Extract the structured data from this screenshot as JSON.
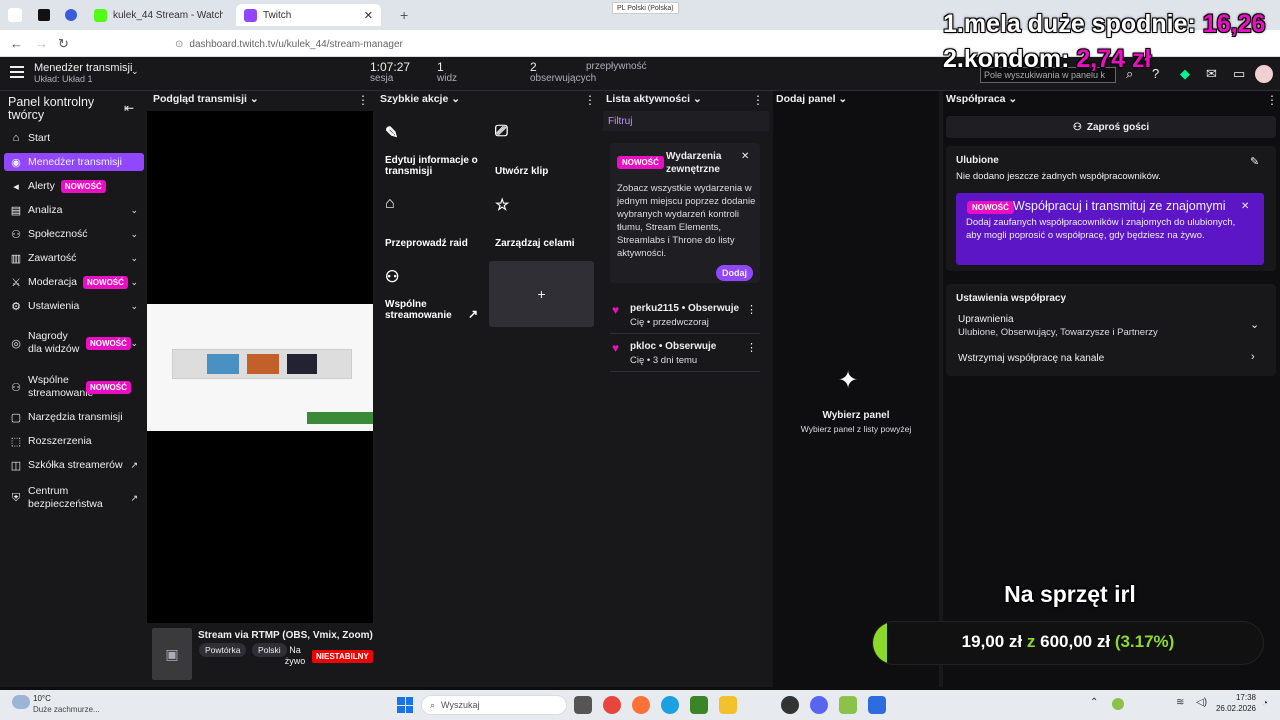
{
  "browser": {
    "tabs": [
      {
        "label": "kulek_44 Stream - Watch Live o"
      },
      {
        "label": "Twitch"
      }
    ],
    "url": "dashboard.twitch.tv/u/kulek_44/stream-manager",
    "lang_indicator": "PL Polski (Polska)"
  },
  "header": {
    "title": "Menedżer transmisji",
    "subtitle": "Układ: Układ 1",
    "stats": [
      {
        "value": "1:07:27",
        "label": "sesja"
      },
      {
        "value": "1",
        "label": "widz"
      },
      {
        "value": "2",
        "label": "obserwujących"
      },
      {
        "value": "",
        "label": "przepływność"
      }
    ],
    "search_placeholder": "Pole wyszukiwania w panelu k"
  },
  "sidebar": {
    "title": "Panel kontrolny twórcy",
    "items": [
      {
        "label": "Start",
        "icon": "home-icon"
      },
      {
        "label": "Menedżer transmisji",
        "icon": "broadcast-icon",
        "active": true
      },
      {
        "label": "Alerty",
        "icon": "megaphone-icon",
        "badge": "NOWOŚĆ"
      },
      {
        "label": "Analiza",
        "icon": "analytics-icon"
      },
      {
        "label": "Społeczność",
        "icon": "community-icon"
      },
      {
        "label": "Zawartość",
        "icon": "content-icon"
      },
      {
        "label": "Moderacja",
        "icon": "sword-icon",
        "badge": "NOWOŚĆ"
      },
      {
        "label": "Ustawienia",
        "icon": "gear-icon"
      },
      {
        "label": "Nagrody dla widzów",
        "icon": "reward-icon",
        "badge": "NOWOŚĆ"
      },
      {
        "label": "Wspólne streamowanie",
        "icon": "add-person-icon",
        "badge": "NOWOŚĆ"
      },
      {
        "label": "Narzędzia transmisji",
        "icon": "tools-icon"
      },
      {
        "label": "Rozszerzenia",
        "icon": "extensions-icon"
      },
      {
        "label": "Szkółka streamerów",
        "icon": "external-link-icon"
      },
      {
        "label": "Centrum bezpieczeństwa",
        "icon": "shield-icon"
      }
    ]
  },
  "panels": {
    "preview": {
      "title": "Podgląd transmisji",
      "stream_title": "Stream via RTMP (OBS, Vmix, Zoom) w",
      "tags": [
        "Powtórka",
        "Polski"
      ],
      "live_label": "Na żywo",
      "status_badge": "NIESTABILNY"
    },
    "quick_actions": {
      "title": "Szybkie akcje",
      "items": [
        {
          "label": "Edytuj informacje o transmisji",
          "icon": "pencil-icon",
          "color": "#9147ff"
        },
        {
          "label": "Utwórz klip",
          "icon": "clip-icon",
          "color": "#9147ff"
        },
        {
          "label": "Przeprowadź raid",
          "icon": "raid-icon",
          "color": "#eb0ec2"
        },
        {
          "label": "Zarządzaj celami",
          "icon": "star-icon",
          "color": "#eb0ec2"
        },
        {
          "label": "Wspólne streamowanie",
          "icon": "add-person-icon",
          "color": "#eb0ec2"
        }
      ],
      "add_label": "+"
    },
    "activity": {
      "title": "Lista aktywności",
      "filter": "Filtruj",
      "card": {
        "badge": "NOWOŚĆ",
        "heading": "Wydarzenia zewnętrzne",
        "body": "Zobacz wszystkie wydarzenia w jednym miejscu poprzez dodanie wybranych wydarzeń kontroli tłumu, Stream Elements, Streamlabs i Throne do listy aktywności.",
        "button": "Dodaj"
      },
      "events": [
        {
          "user": "perku2115",
          "action": "Obserwuje",
          "meta": "Cię • przedwczoraj"
        },
        {
          "user": "pkloc",
          "action": "Obserwuje",
          "meta": "Cię • 3 dni temu"
        }
      ]
    },
    "add_panel": {
      "title": "Dodaj panel",
      "empty_title": "Wybierz panel",
      "empty_sub": "Wybierz panel z listy powyżej"
    },
    "collab": {
      "title": "Współpraca",
      "invite_button": "Zaproś gości",
      "favorites_title": "Ulubione",
      "favorites_empty": "Nie dodano jeszcze żadnych współpracowników.",
      "promo_badge": "NOWOŚĆ",
      "promo_title": "Współpracuj i transmituj ze znajomymi",
      "promo_body": "Dodaj zaufanych współpracowników i znajomych do ulubionych, aby mogli poprosić o współpracę, gdy będziesz na żywo.",
      "settings_title": "Ustawienia współpracy",
      "permissions_label": "Uprawnienia",
      "permissions_value": "Ulubione, Obserwujący, Towarzysze i Partnerzy",
      "pause_label": "Wstrzymaj współpracę na kanale"
    }
  },
  "overlay": {
    "line1_text": "1.mela duże spodnie:",
    "line1_amount": "16,26",
    "line2_text": "2.kondom:",
    "line2_amount": "2,74 zł",
    "goal_title": "Na sprzęt irl",
    "goal_current": "19,00 zł",
    "goal_sep": "z",
    "goal_target": "600,00 zł",
    "goal_percent": "(3.17%)",
    "goal_fraction": 0.0317,
    "accent": "#eb0ec2",
    "goal_color": "#8cd92b"
  },
  "taskbar": {
    "weather_temp": "10°C",
    "weather_desc": "Duże zachmurze...",
    "search_placeholder": "Wyszukaj",
    "time": "17:38",
    "date": "26.02.2026"
  }
}
